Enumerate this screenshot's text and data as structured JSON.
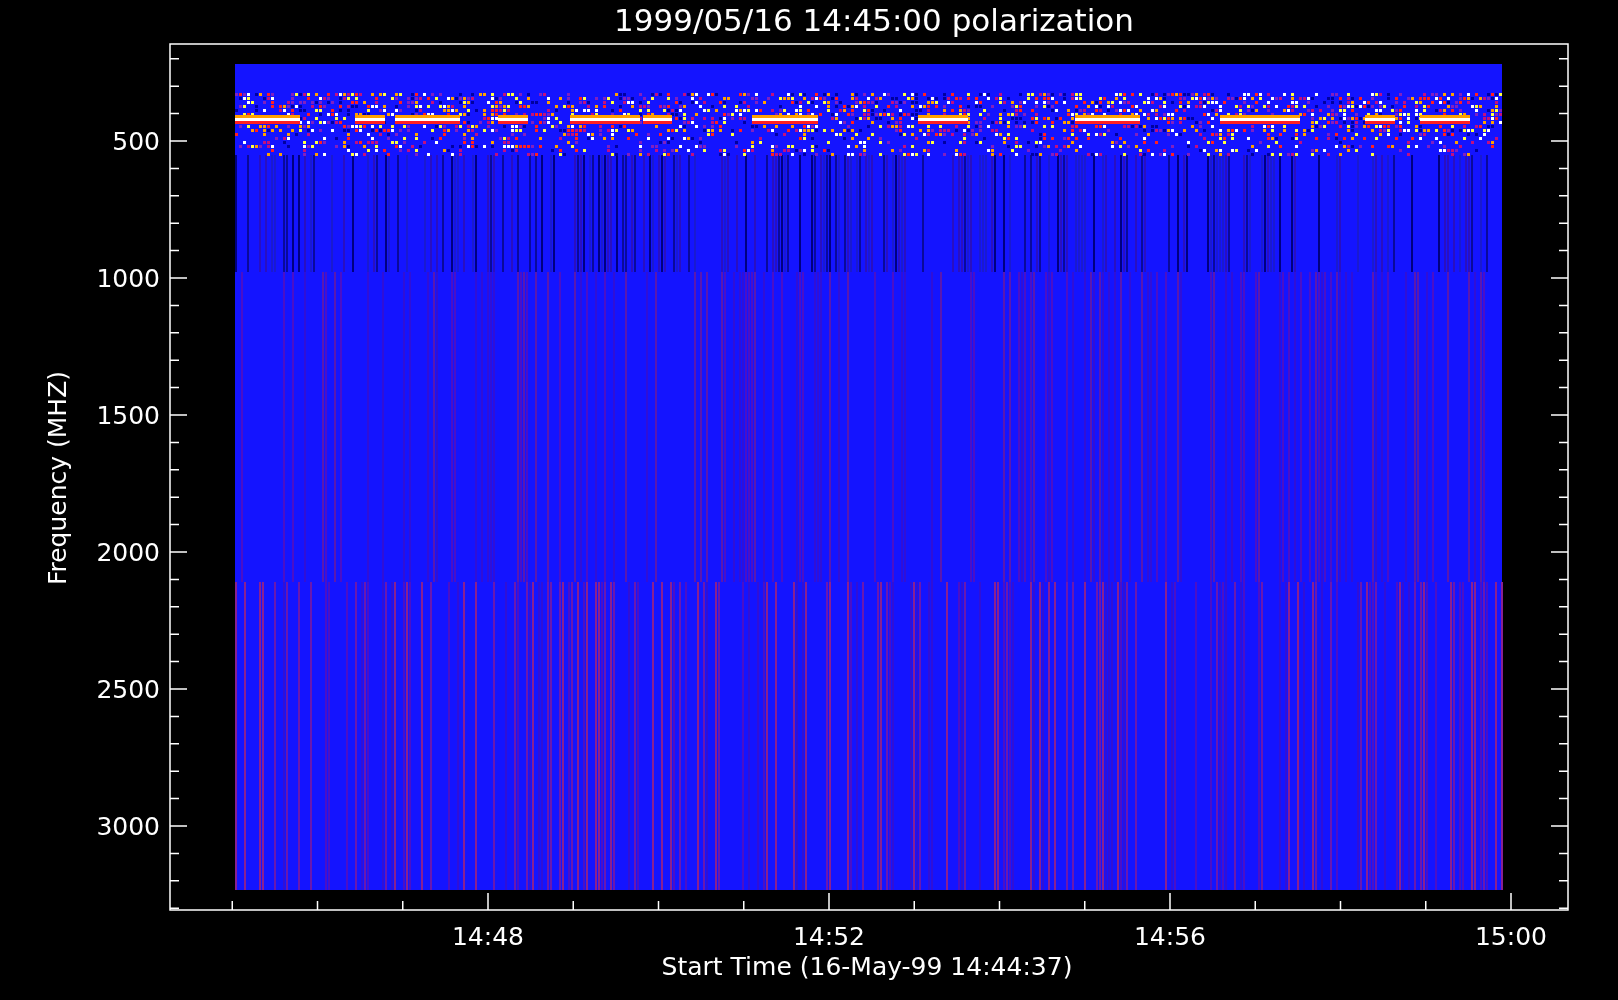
{
  "plot": {
    "title": "1999/05/16 14:45:00 polarization",
    "ylabel": "Frequency (MHZ)",
    "xlabel": "Start Time (16-May-99 14:44:37)",
    "yticks": [
      "500",
      "1000",
      "1500",
      "2000",
      "2500",
      "3000"
    ],
    "xticks": [
      "14:48",
      "14:52",
      "14:56",
      "15:00"
    ]
  }
}
